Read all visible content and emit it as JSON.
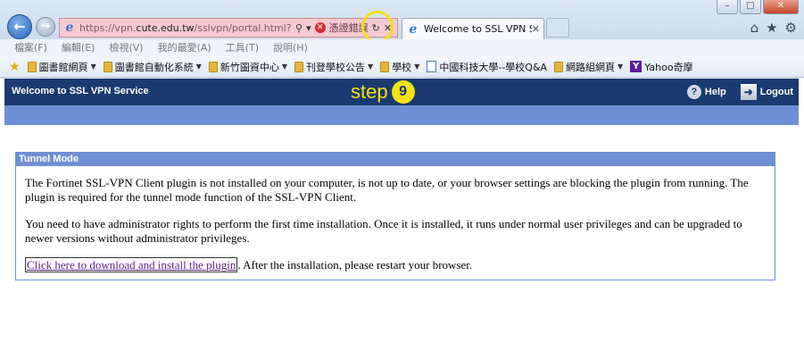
{
  "browser": {
    "url_prefix": "https://vpn.",
    "url_domain": "cute.edu.tw",
    "url_suffix": "/sslvpn/portal.html?lang=en",
    "cert_error": "憑證錯誤",
    "tab_title": "Welcome to SSL VPN Ser...",
    "window_controls": {
      "minimize": "–",
      "maximize": "□",
      "close": "✕"
    }
  },
  "menu": [
    "檔案(F)",
    "編輯(E)",
    "檢視(V)",
    "我的最愛(A)",
    "工具(T)",
    "說明(H)"
  ],
  "favorites": [
    {
      "label": "圖書館網頁",
      "icon": "folder-icon",
      "dropdown": true
    },
    {
      "label": "圖書館自動化系統",
      "icon": "folder-icon",
      "dropdown": true
    },
    {
      "label": "新竹圖資中心",
      "icon": "folder-icon",
      "dropdown": true
    },
    {
      "label": "刊登學校公告",
      "icon": "folder-icon",
      "dropdown": true
    },
    {
      "label": "學校",
      "icon": "folder-icon",
      "dropdown": true
    },
    {
      "label": "中國科技大學--學校Q&A",
      "icon": "page-icon",
      "dropdown": false
    },
    {
      "label": "網路組網頁",
      "icon": "folder-icon",
      "dropdown": true
    },
    {
      "label": "Yahoo奇摩",
      "icon": "yahoo-icon",
      "dropdown": false
    }
  ],
  "ssl": {
    "title": "Welcome to SSL VPN Service",
    "step_label": "step",
    "step_number": "9",
    "help": "Help",
    "logout": "Logout"
  },
  "panel": {
    "title": "Tunnel Mode",
    "para1": "The Fortinet SSL-VPN Client plugin is not installed on your computer, is not up to date, or your browser settings are blocking the plugin from running. The plugin is required for the tunnel mode function of the SSL-VPN Client.",
    "para2": "You need to have administrator rights to perform the first time installation. Once it is installed, it runs under normal user privileges and can be upgraded to newer versions without administrator privileges.",
    "link": "Click here to download and install the plugin",
    "after_link": ". After the installation, please restart your browser."
  },
  "colors": {
    "header": "#1b3a70",
    "bar": "#6f8fd4",
    "step": "#f3e20f",
    "link": "#5d1d82"
  }
}
